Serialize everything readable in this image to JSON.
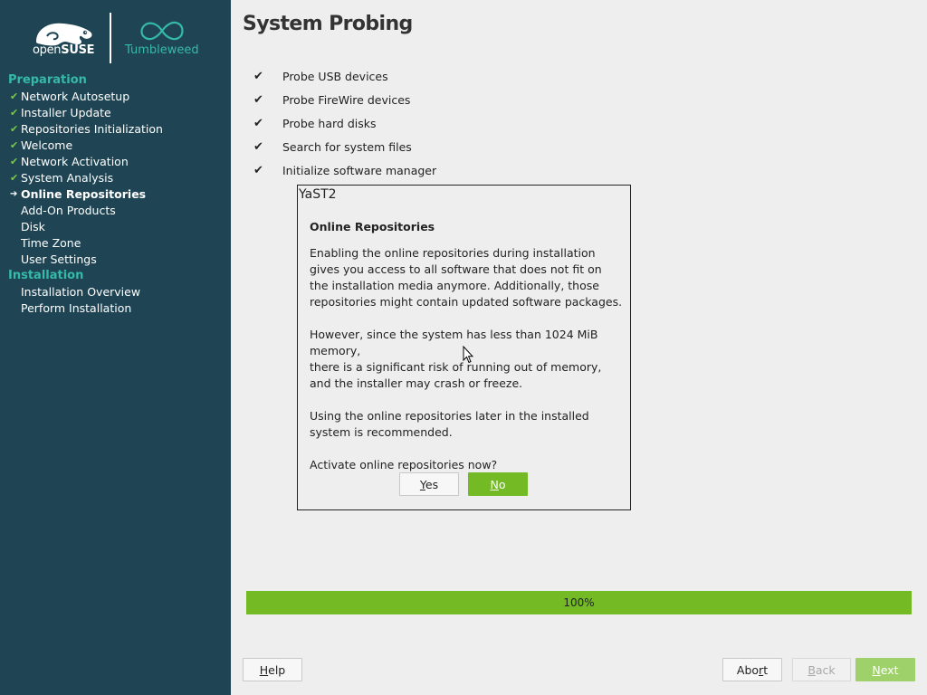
{
  "branding": {
    "suse_text_prefix": "open",
    "suse_text_bold": "SUSE",
    "distro_name": "Tumbleweed"
  },
  "sidebar": {
    "sections": [
      {
        "title": "Preparation",
        "steps": [
          {
            "label": "Network Autosetup",
            "state": "done"
          },
          {
            "label": "Installer Update",
            "state": "done"
          },
          {
            "label": "Repositories Initialization",
            "state": "done"
          },
          {
            "label": "Welcome",
            "state": "done"
          },
          {
            "label": "Network Activation",
            "state": "done"
          },
          {
            "label": "System Analysis",
            "state": "done"
          },
          {
            "label": "Online Repositories",
            "state": "current"
          },
          {
            "label": "Add-On Products",
            "state": "pending"
          },
          {
            "label": "Disk",
            "state": "pending"
          },
          {
            "label": "Time Zone",
            "state": "pending"
          },
          {
            "label": "User Settings",
            "state": "pending"
          }
        ]
      },
      {
        "title": "Installation",
        "steps": [
          {
            "label": "Installation Overview",
            "state": "pending"
          },
          {
            "label": "Perform Installation",
            "state": "pending"
          }
        ]
      }
    ],
    "done_glyph": "✔",
    "current_glyph": "➔"
  },
  "main": {
    "title": "System Probing",
    "probe_glyph": "✔",
    "probe_items": [
      "Probe USB devices",
      "Probe FireWire devices",
      "Probe hard disks",
      "Search for system files",
      "Initialize software manager"
    ]
  },
  "dialog": {
    "window_title": "YaST2",
    "heading": "Online Repositories",
    "body": "Enabling the online repositories during installation\ngives you access to all software that does not fit on\nthe installation media anymore. Additionally, those\nrepositories might contain updated software packages.\n\nHowever, since the system has less than 1024 MiB memory,\nthere is a significant risk of running out of memory,\nand the installer may crash or freeze.\n\nUsing the online repositories later in the installed\nsystem is recommended.\n\nActivate online repositories now?",
    "yes_label": {
      "mnemonic": "Y",
      "rest": "es"
    },
    "no_label": {
      "mnemonic": "N",
      "rest": "o"
    }
  },
  "progress": {
    "value": 1.0,
    "label": "100%"
  },
  "bottom_bar": {
    "help": {
      "mnemonic": "H",
      "rest": "elp"
    },
    "abort": {
      "pre": "Abo",
      "mnemonic": "r",
      "rest": "t"
    },
    "back": {
      "mnemonic": "B",
      "rest": "ack"
    },
    "next": {
      "mnemonic": "N",
      "rest": "ext"
    }
  },
  "colors": {
    "sidebar_bg": "#1f4554",
    "accent_teal": "#35b9ab",
    "accent_green": "#73ba25",
    "check_green": "#7ac943"
  }
}
